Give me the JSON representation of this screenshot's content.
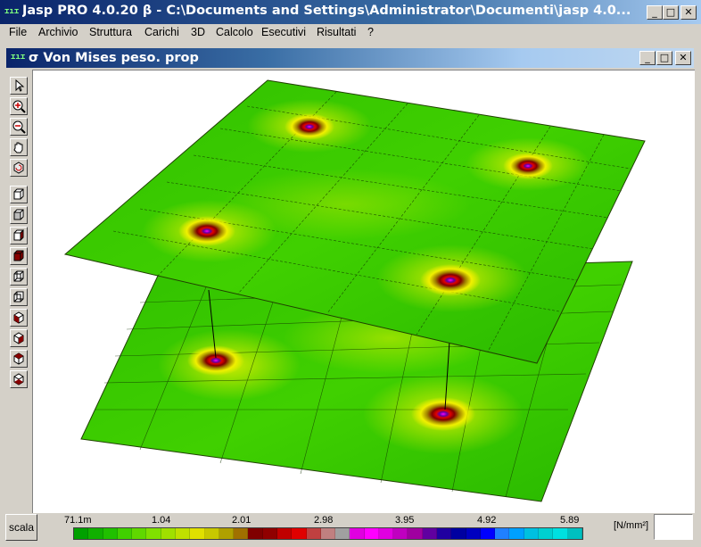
{
  "app": {
    "title": "Jasp PRO 4.0.20 β - C:\\Documents and Settings\\Administrator\\Documenti\\jasp 4.0..."
  },
  "window_controls": {
    "minimize": "_",
    "maximize": "□",
    "close": "✕"
  },
  "menu": [
    "File",
    "Archivio",
    "Struttura",
    "Carichi",
    "3D",
    "Calcolo",
    "Esecutivi",
    "Risultati",
    "?"
  ],
  "document": {
    "title": "σ Von Mises peso. prop"
  },
  "toolbar": {
    "tools": [
      "pointer-icon",
      "zoom-in-icon",
      "zoom-out-icon",
      "pan-hand-icon",
      "rotate-icon",
      "view-cube-1-icon",
      "view-cube-2-icon",
      "view-cube-3-icon",
      "view-cube-4-icon",
      "view-cube-5-icon",
      "view-cube-6-icon",
      "view-cube-7-icon",
      "view-cube-8-icon",
      "view-cube-9-icon",
      "view-cube-10-icon"
    ]
  },
  "legend": {
    "button": "scala",
    "ticks": [
      "71.1m",
      "1.04",
      "2.01",
      "2.98",
      "3.95",
      "4.92",
      "5.89"
    ],
    "unit": "[N/mm²]",
    "colors": [
      "#00a000",
      "#10b000",
      "#20c000",
      "#40d000",
      "#60d800",
      "#80e000",
      "#a0e000",
      "#c0e000",
      "#e0e000",
      "#c8c800",
      "#b0a000",
      "#a07000",
      "#800000",
      "#900000",
      "#c00000",
      "#e00000",
      "#c04040",
      "#c08080",
      "#a0a0a0",
      "#e000e0",
      "#ff00ff",
      "#e000e0",
      "#c000c0",
      "#a000a0",
      "#6000a0",
      "#2000a0",
      "#0000a0",
      "#0000c0",
      "#0000ff",
      "#2080ff",
      "#00a0ff",
      "#00c0e0",
      "#00d0d0",
      "#00e0e0",
      "#00c0c0"
    ]
  }
}
